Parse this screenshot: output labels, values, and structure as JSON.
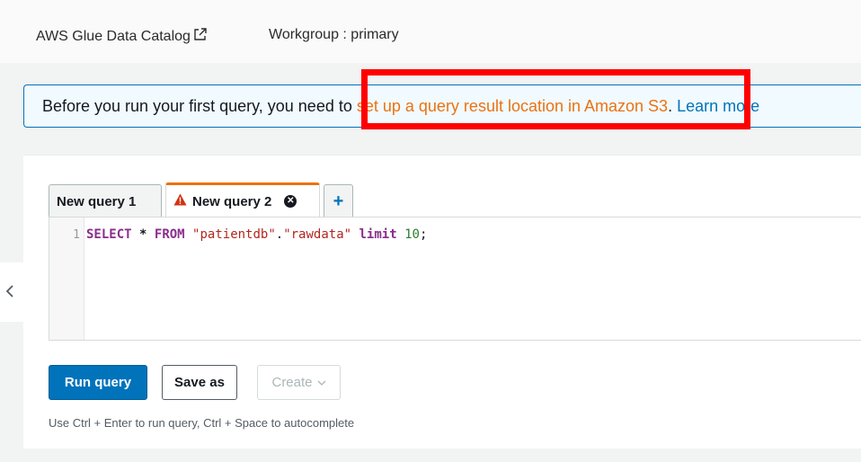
{
  "topbar": {
    "catalog_link": "AWS Glue Data Catalog",
    "workgroup": "Workgroup : primary"
  },
  "banner": {
    "prefix": "Before you run your first query, you need to ",
    "s3_link": "set up a query result location in Amazon S3",
    "separator": ". ",
    "learn_more": "Learn more"
  },
  "tabs": [
    {
      "label": "New query 1"
    },
    {
      "label": "New query 2",
      "warning": true,
      "active": true
    }
  ],
  "add_tab_label": "+",
  "editor": {
    "line_number": "1",
    "tokens": {
      "select": "SELECT",
      "star": "*",
      "from": "FROM",
      "db": "\"patientdb\"",
      "dot": ".",
      "table": "\"rawdata\"",
      "limit": "limit",
      "count": "10",
      "semicolon": ";"
    }
  },
  "buttons": {
    "run": "Run query",
    "save_as": "Save as",
    "create": "Create"
  },
  "hint": "Use Ctrl + Enter to run query, Ctrl + Space to autocomplete",
  "colors": {
    "accent": "#0073bb",
    "link_orange": "#ec7211",
    "highlight_box": "#ff0000",
    "warning": "#d13212"
  }
}
